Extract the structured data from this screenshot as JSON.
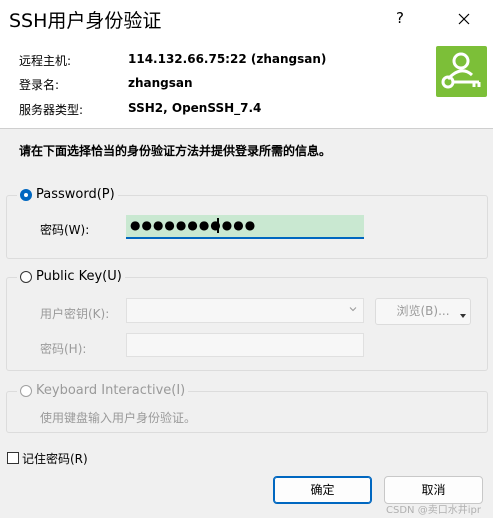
{
  "window": {
    "title": "SSH用户身份验证",
    "help_label": "?",
    "close_icon": "close-icon"
  },
  "info": {
    "host_label": "远程主机:",
    "host_value": "114.132.66.75:22 (zhangsan)",
    "login_label": "登录名:",
    "login_value": "zhangsan",
    "server_type_label": "服务器类型:",
    "server_type_value": "SSH2, OpenSSH_7.4",
    "logo_icon": "user-key-icon",
    "logo_color": "#7cbf38"
  },
  "instruction": "请在下面选择恰当的身份验证方法并提供登录所需的信息。",
  "password_group": {
    "radio_label": "Password(P)",
    "selected": true,
    "password_label": "密码(W):",
    "password_value": "●●●●●●●●●●●"
  },
  "public_key_group": {
    "radio_label": "Public Key(U)",
    "selected": false,
    "user_key_label": "用户密钥(K):",
    "user_key_value": "",
    "browse_label": "浏览(B)...",
    "passphrase_label": "密码(H):",
    "passphrase_value": ""
  },
  "keyboard_group": {
    "radio_label": "Keyboard Interactive(I)",
    "selected": false,
    "description": "使用键盘输入用户身份验证。"
  },
  "remember": {
    "label": "记住密码(R)",
    "checked": false
  },
  "buttons": {
    "ok_label": "确定",
    "cancel_label": "取消"
  },
  "watermark": "CSDN @卖口水井ipr",
  "colors": {
    "accent": "#0067c0",
    "password_field_bg": "#c9e8d1"
  }
}
